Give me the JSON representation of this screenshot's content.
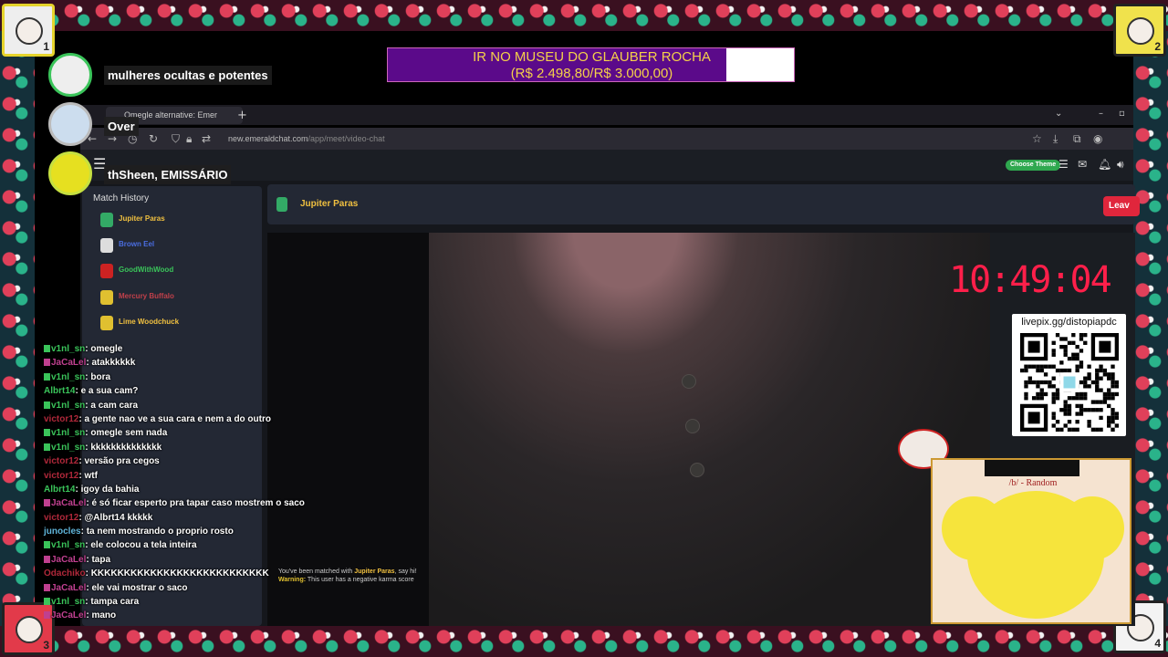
{
  "banner": {
    "line1": "IR NO MUSEU DO GLAUBER ROCHA",
    "line2": "(R$ 2.498,80/R$ 3.000,00)",
    "progress_fraction": 0.833,
    "fill_color": "#5b0a8a"
  },
  "overlay": {
    "viewer1_name": "mulheres ocultas e potentes",
    "viewer2_name": "Over",
    "viewer3_name": "thSheen, EMISSÁRIO"
  },
  "corners": [
    "1",
    "2",
    "3",
    "4"
  ],
  "browser": {
    "tab_title": "Omegle alternative: Emer",
    "new_tab": "+",
    "url_host": "new.emeraldchat.com",
    "url_path": "/app/meet/video-chat"
  },
  "app": {
    "theme_button": "Choose Theme",
    "match_history_title": "Match History",
    "match_history": [
      {
        "name": "Jupiter Paras",
        "color": "#f0c040",
        "icon_color": "#3a6"
      },
      {
        "name": "Brown Eel",
        "color": "#4a6de0",
        "icon_color": "#ddd"
      },
      {
        "name": "GoodWithWood",
        "color": "#3ac45a",
        "icon_color": "#c22"
      },
      {
        "name": "Mercury Buffalo",
        "color": "#c0404a",
        "icon_color": "#e0c030"
      },
      {
        "name": "Lime Woodchuck",
        "color": "#f0c040",
        "icon_color": "#e0c030"
      }
    ],
    "peer_name": "Jupiter Paras",
    "leave_button": "Leav",
    "system_message": {
      "prefix": "You've been matched with",
      "name": "Jupiter Paras",
      "suffix": ", say hi!",
      "warning_label": "Warning:",
      "warning_text": "This user has a negative karma score"
    }
  },
  "clock": "10:49:04",
  "qr": {
    "title": "livepix.gg/distopiapdc"
  },
  "mascot": {
    "board_title": "/b/ - Random"
  },
  "chat": [
    {
      "user": "v1nl_sn",
      "color": "#3ac45a",
      "badge": "#3ac45a",
      "text": "omegle"
    },
    {
      "user": "JaCaLel",
      "color": "#c04090",
      "badge": "#c04090",
      "text": "atakkkkkk"
    },
    {
      "user": "v1nl_sn",
      "color": "#3ac45a",
      "badge": "#3ac45a",
      "text": "bora"
    },
    {
      "user": "Albrt14",
      "color": "#3ac45a",
      "badge": "",
      "text": "e a sua cam?"
    },
    {
      "user": "v1nl_sn",
      "color": "#3ac45a",
      "badge": "#3ac45a",
      "text": "a cam cara"
    },
    {
      "user": "victor12",
      "color": "#b0283a",
      "badge": "",
      "text": "a gente nao ve a sua cara e nem a do outro"
    },
    {
      "user": "v1nl_sn",
      "color": "#3ac45a",
      "badge": "#3ac45a",
      "text": "omegle sem nada"
    },
    {
      "user": "v1nl_sn",
      "color": "#3ac45a",
      "badge": "#3ac45a",
      "text": "kkkkkkkkkkkkkk"
    },
    {
      "user": "victor12",
      "color": "#b0283a",
      "badge": "",
      "text": "versão pra cegos"
    },
    {
      "user": "victor12",
      "color": "#b0283a",
      "badge": "",
      "text": "wtf"
    },
    {
      "user": "Albrt14",
      "color": "#3ac45a",
      "badge": "",
      "text": "igoy da bahia"
    },
    {
      "user": "JaCaLel",
      "color": "#c04090",
      "badge": "#c04090",
      "text": "é só ficar esperto pra tapar caso mostrem o saco"
    },
    {
      "user": "victor12",
      "color": "#b0283a",
      "badge": "",
      "text": "@Albrt14 kkkkk"
    },
    {
      "user": "junocles",
      "color": "#5fb3d8",
      "badge": "",
      "text": "ta nem mostrando o proprio rosto"
    },
    {
      "user": "v1nl_sn",
      "color": "#3ac45a",
      "badge": "#3ac45a",
      "text": "ele colocou a tela inteira"
    },
    {
      "user": "JaCaLel",
      "color": "#c04090",
      "badge": "#c04090",
      "text": "tapa"
    },
    {
      "user": "Odachiko",
      "color": "#b0283a",
      "badge": "",
      "text": "KKKKKKKKKKKKKKKKKKKKKKKKKKK"
    },
    {
      "user": "JaCaLel",
      "color": "#c04090",
      "badge": "#c04090",
      "text": "ele vai mostrar o saco"
    },
    {
      "user": "v1nl_sn",
      "color": "#3ac45a",
      "badge": "#3ac45a",
      "text": "tampa cara"
    },
    {
      "user": "JaCaLel",
      "color": "#c04090",
      "badge": "#c04090",
      "text": "mano"
    }
  ]
}
